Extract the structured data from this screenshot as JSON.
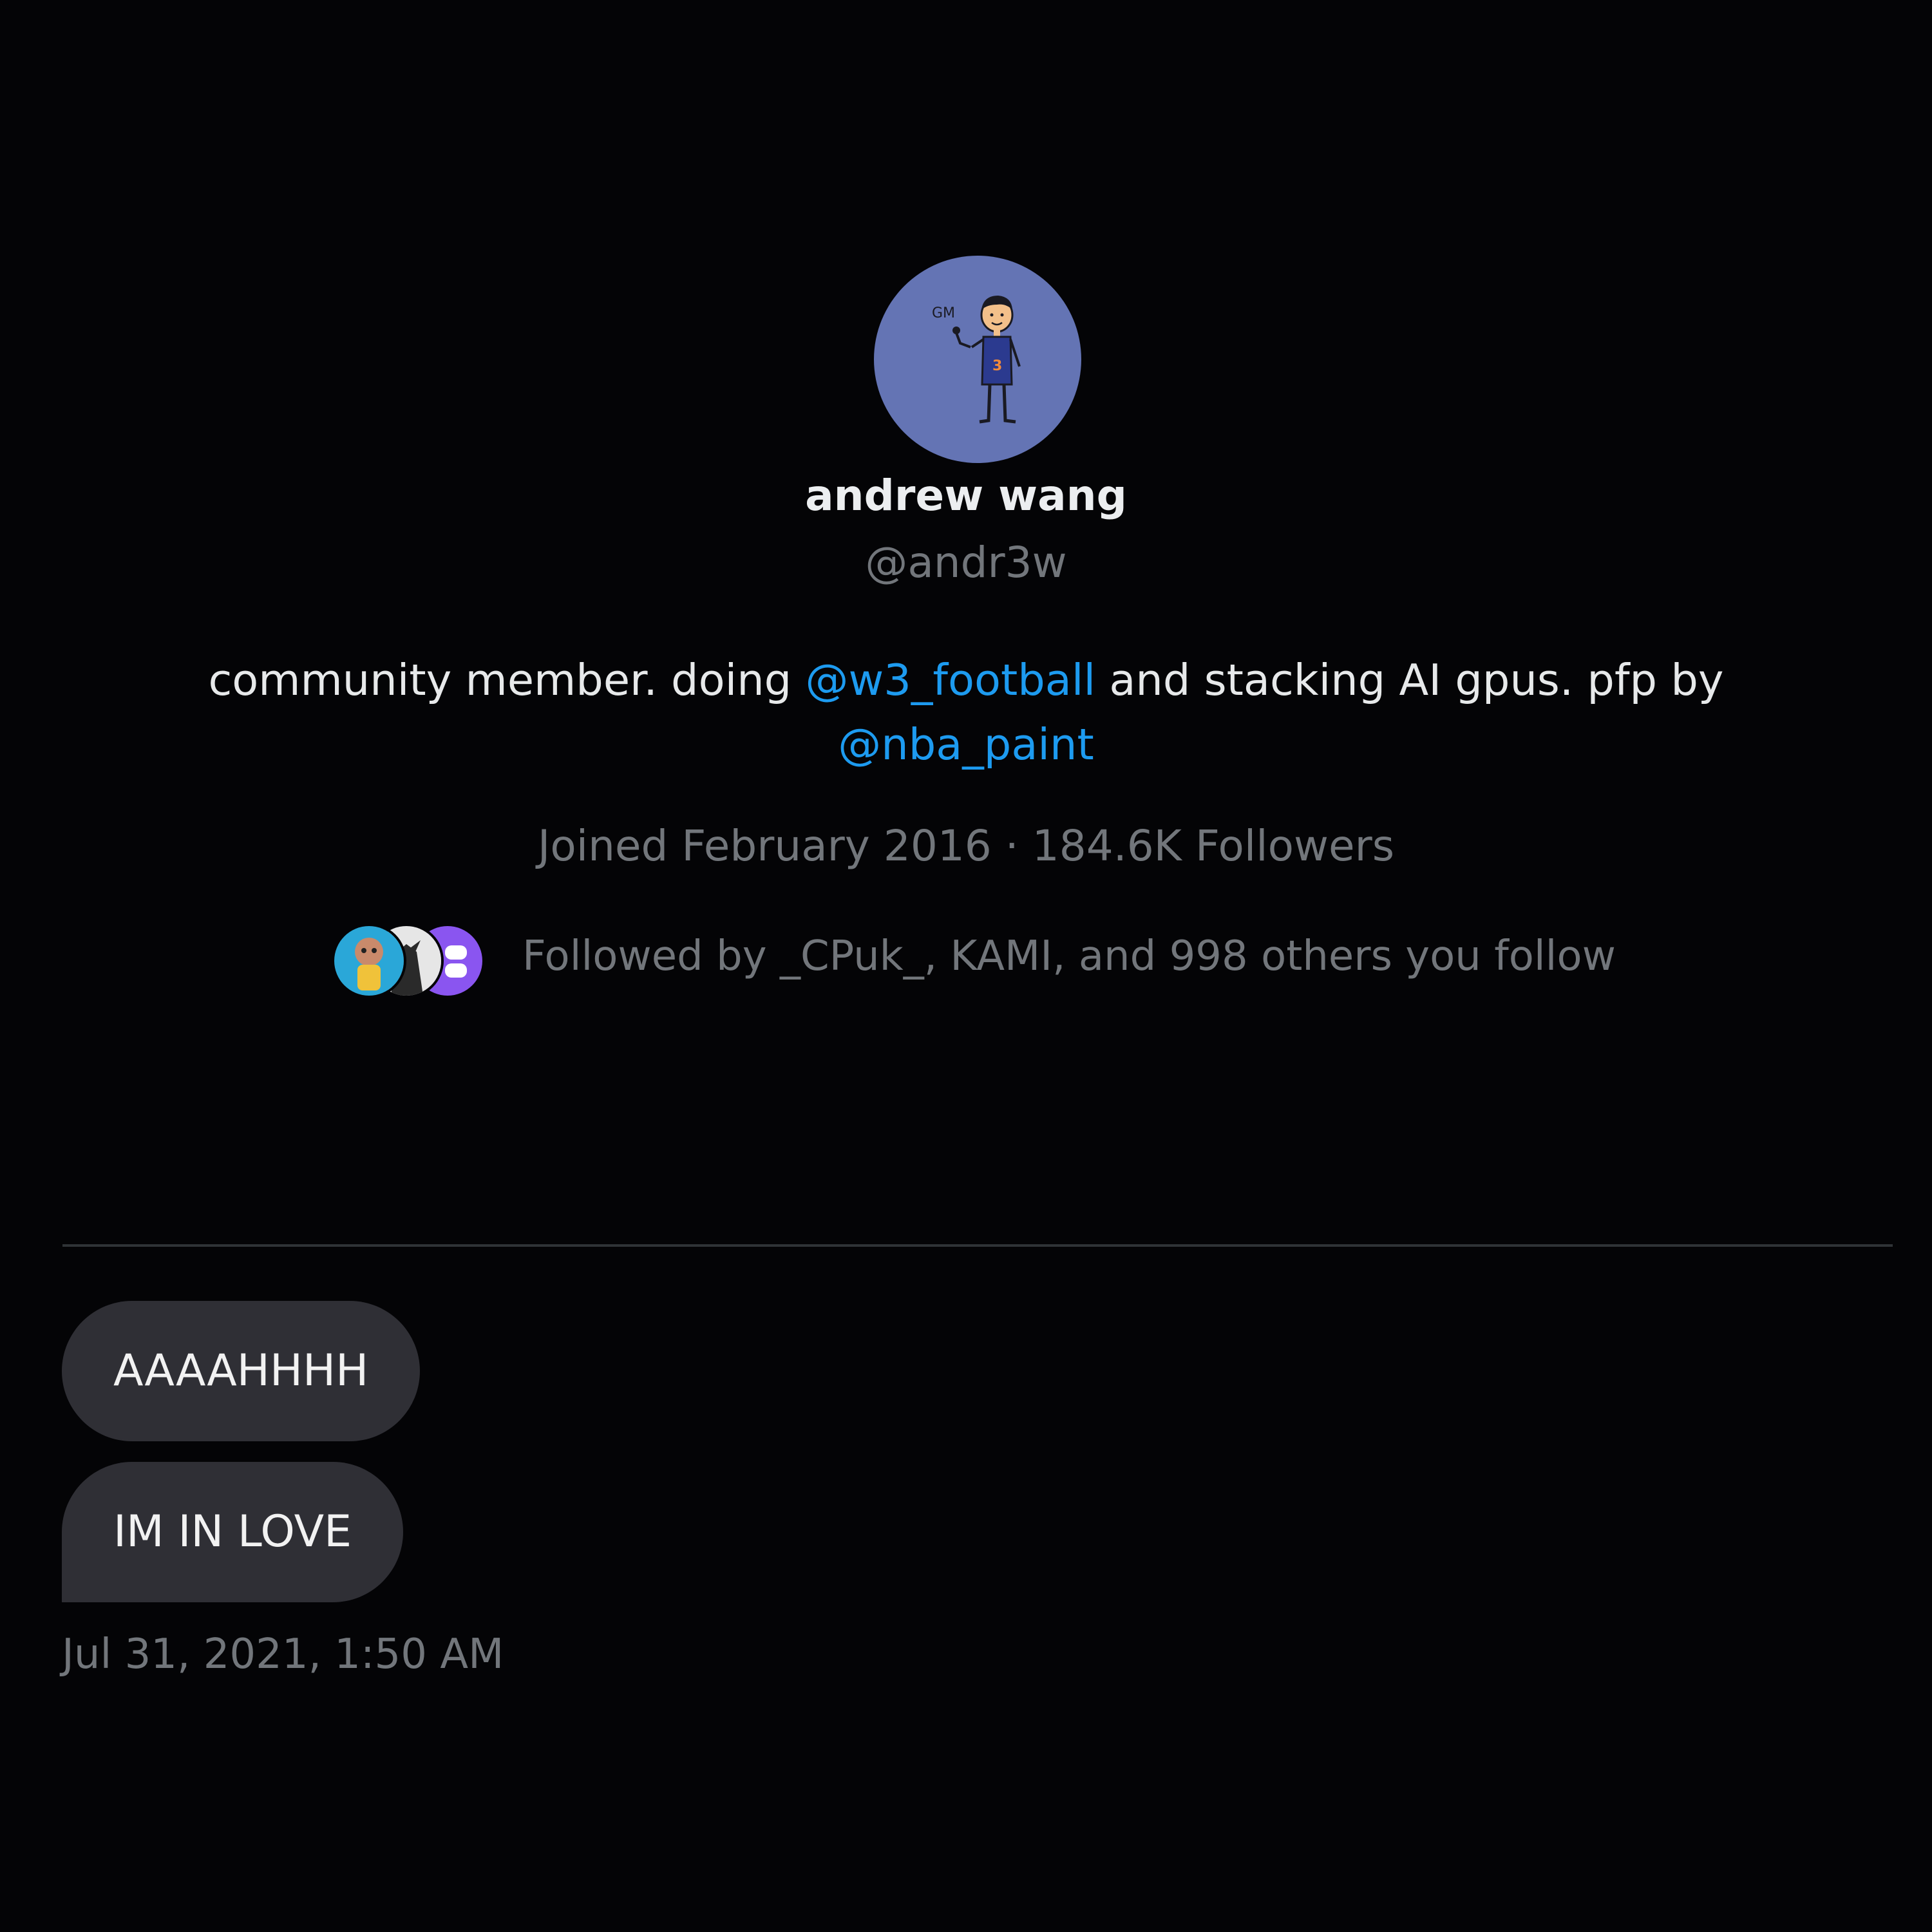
{
  "profile": {
    "avatar_icon": "cartoon-person-avatar-icon",
    "avatar_text": "GM",
    "avatar_jersey_number": "3",
    "display_name": "andrew wang",
    "handle": "@andr3w",
    "bio": {
      "part1": "community member. doing ",
      "mention1": "@w3_football",
      "part2": " and stacking AI gpus. pfp by",
      "mention2": "@nba_paint"
    },
    "meta": "Joined February 2016 · 184.6K Followers",
    "followed_by": "Followed by _CPuk_, KAMI, and 998 others you follow"
  },
  "messages": [
    {
      "text": "AAAAHHHH"
    },
    {
      "text": "IM IN LOVE"
    }
  ],
  "timestamp": "Jul 31, 2021, 1:50 AM",
  "colors": {
    "background": "#040406",
    "avatar_bg": "#6474b4",
    "mention": "#1d9bf0",
    "muted": "#72767b",
    "bubble": "#2f2f35"
  }
}
